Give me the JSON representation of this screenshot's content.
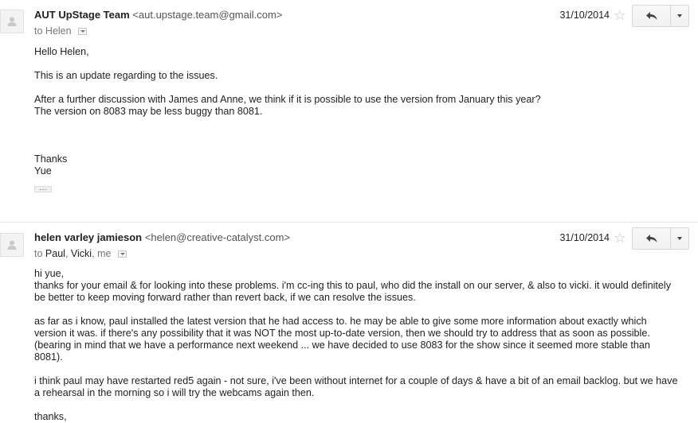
{
  "messages": [
    {
      "sender_name": "AUT UpStage Team",
      "sender_email": "<aut.upstage.team@gmail.com>",
      "to_prefix": "to",
      "recipients": [
        "Helen"
      ],
      "date": "31/10/2014",
      "body": [
        "Hello Helen,",
        "This is an update regarding to the issues.",
        "After a further discussion with James and Anne, we think if it is possible to use the version from January this year?",
        "The version on 8083 may be less buggy than 8081.",
        "Thanks",
        "Yue"
      ],
      "trimmed_content_label": "…"
    },
    {
      "sender_name": "helen varley jamieson",
      "sender_email": "<helen@creative-catalyst.com>",
      "to_prefix": "to",
      "recipients": [
        "Paul",
        "Vicki",
        "me"
      ],
      "date": "31/10/2014",
      "body": [
        "hi yue,",
        "thanks for your email & for looking into these problems. i'm cc-ing this to paul, who did the install on our server, & also to vicki. it would definitely be better to keep moving forward rather than revert back, if we can resolve the issues.",
        "as far as i know, paul installed the latest version that he had access to. he may be able to give some more information about exactly which version it was. if there's any possibility that it was NOT the most up-to-date version, then we should try to address that as soon as possible. (bearing in mind that we have a performance next weekend ... we have decided to use 8083 for the show since it seemed more stable than 8081).",
        "i think paul may have restarted red5 again - not sure, i've been without internet for a couple of days & have a bit of an email backlog. but we have a rehearsal in the morning so i will try the webcams again then.",
        "thanks,"
      ]
    }
  ],
  "icons": {
    "avatar": "person-icon",
    "star": "star-icon",
    "reply": "reply-icon",
    "more": "chevron-down-icon"
  },
  "colors": {
    "muted_text": "#777777",
    "star": "#c8c8c8",
    "button_border": "#d8d8d8"
  }
}
